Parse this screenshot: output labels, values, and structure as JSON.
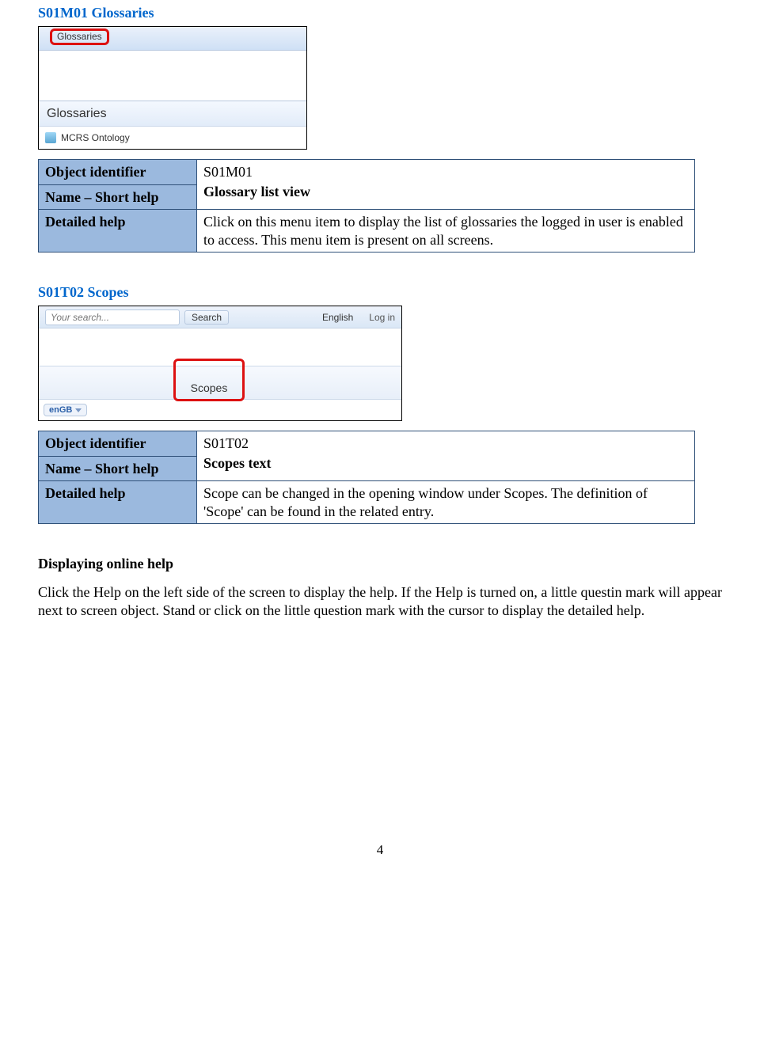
{
  "section1": {
    "heading": "S01M01 Glossaries",
    "shot": {
      "tab_label": "Glossaries",
      "bar_title": "Glossaries",
      "item_label": "MCRS Ontology"
    },
    "table": {
      "row1_label": "Object identifier",
      "row1_value": "S01M01",
      "row2_label": "Name – Short help",
      "row2_value": "Glossary list view",
      "row3_label": "Detailed help",
      "row3_value": "Click on this menu item to display the list of glossaries the logged in user is enabled to access. This menu item is present on all screens."
    }
  },
  "section2": {
    "heading": "S01T02 Scopes",
    "shot": {
      "search_placeholder": "Your search...",
      "search_btn": "Search",
      "lang_link": "English",
      "login_link": "Log in",
      "scopes_label": "Scopes",
      "lang_pill": "enGB"
    },
    "table": {
      "row1_label": "Object identifier",
      "row1_value": "S01T02",
      "row2_label": "Name – Short help",
      "row2_value": "Scopes text",
      "row3_label": "Detailed help",
      "row3_value": "Scope can be changed in the opening window under Scopes. The definition of 'Scope' can be found in the related entry."
    }
  },
  "body": {
    "heading": "Displaying online help",
    "paragraph": "Click the Help on the left side of the screen to display the help. If the Help is turned on, a little questin mark will appear next to screen object. Stand or click on the little question mark with the cursor to display the detailed help."
  },
  "page_number": "4"
}
